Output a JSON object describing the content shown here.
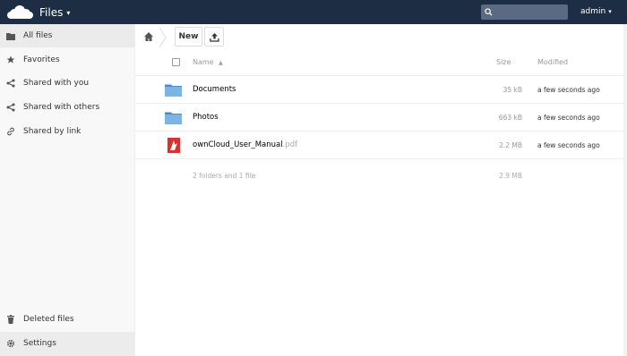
{
  "header": {
    "app_title": "Files",
    "app_caret": "▾",
    "user": "admin",
    "user_caret": "▾",
    "search_placeholder": ""
  },
  "sidebar": {
    "items": [
      {
        "label": "All files",
        "icon": "folder-icon",
        "active": true
      },
      {
        "label": "Favorites",
        "icon": "star-icon"
      },
      {
        "label": "Shared with you",
        "icon": "share-icon"
      },
      {
        "label": "Shared with others",
        "icon": "share-icon"
      },
      {
        "label": "Shared by link",
        "icon": "link-icon"
      }
    ],
    "deleted": {
      "label": "Deleted files",
      "icon": "trash-icon"
    },
    "settings": {
      "label": "Settings",
      "icon": "gear-icon"
    }
  },
  "controls": {
    "new_label": "New",
    "upload_icon": "upload-icon",
    "home_icon": "home-icon"
  },
  "table": {
    "headers": {
      "name": "Name",
      "sort_indicator": "▲",
      "size": "Size",
      "modified": "Modified"
    },
    "rows": [
      {
        "name": "Documents",
        "ext": "",
        "size": "35 kB",
        "modified": "a few seconds ago",
        "icon": "folder-icon"
      },
      {
        "name": "Photos",
        "ext": "",
        "size": "663 kB",
        "modified": "a few seconds ago",
        "icon": "folder-icon"
      },
      {
        "name": "ownCloud_User_Manual",
        "ext": ".pdf",
        "size": "2.2 MB",
        "modified": "a few seconds ago",
        "icon": "pdf-icon"
      }
    ],
    "summary": {
      "text": "2 folders and 1 file",
      "size": "2.9 MB"
    }
  },
  "colors": {
    "header_bg": "#1d2d44",
    "folder_blue": "#5b9bd5",
    "pdf_red": "#d9322e"
  }
}
